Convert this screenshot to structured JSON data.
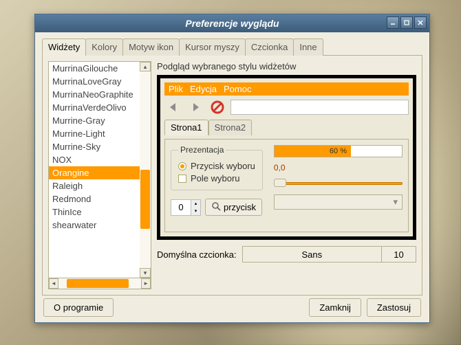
{
  "window": {
    "title": "Preferencje wyglądu"
  },
  "tabs": {
    "widgets": "Widżety",
    "colors": "Kolory",
    "icon_theme": "Motyw ikon",
    "cursor": "Kursor myszy",
    "font": "Czcionka",
    "other": "Inne"
  },
  "themes": [
    "MurrinaGilouche",
    "MurrinaLoveGray",
    "MurrinaNeoGraphite",
    "MurrinaVerdeOlivo",
    "Murrine-Gray",
    "Murrine-Light",
    "Murrine-Sky",
    "NOX",
    "Orangine",
    "Raleigh",
    "Redmond",
    "ThinIce",
    "shearwater"
  ],
  "selected_theme_index": 8,
  "preview": {
    "label": "Podgląd wybranego stylu widżetów",
    "menu": {
      "file": "Plik",
      "edit": "Edycja",
      "help": "Pomoc"
    },
    "tabs": {
      "page1": "Strona1",
      "page2": "Strona2"
    },
    "group_title": "Prezentacja",
    "radio_label": "Przycisk wyboru",
    "check_label": "Pole wyboru",
    "spinner_value": "0",
    "button_label": "przycisk",
    "progress_pct": 60,
    "progress_text": "60 %",
    "scale_value": "0,0"
  },
  "default_font": {
    "label": "Domyślna czcionka:",
    "name": "Sans",
    "size": "10"
  },
  "footer": {
    "about": "O programie",
    "close": "Zamknij",
    "apply": "Zastosuj"
  }
}
